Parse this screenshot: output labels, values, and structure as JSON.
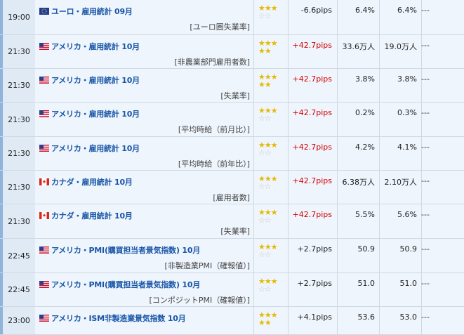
{
  "rows": [
    {
      "time": "19:00",
      "flag": "eu",
      "name": "ユーロ・雇用統計 09月",
      "sub": "[ユーロ圏失業率]",
      "stars_on": 3,
      "pips": "-6.6pips",
      "pips_sign": "neg",
      "prev": "6.4%",
      "forecast": "6.4%",
      "actual": "---"
    },
    {
      "time": "21:30",
      "flag": "us",
      "name": "アメリカ・雇用統計 10月",
      "sub": "[非農業部門雇用者数]",
      "stars_on": 5,
      "pips": "+42.7pips",
      "pips_sign": "pos",
      "prev": "33.6万人",
      "forecast": "19.0万人",
      "actual": "---"
    },
    {
      "time": "21:30",
      "flag": "us",
      "name": "アメリカ・雇用統計 10月",
      "sub": "[失業率]",
      "stars_on": 5,
      "pips": "+42.7pips",
      "pips_sign": "pos",
      "prev": "3.8%",
      "forecast": "3.8%",
      "actual": "---"
    },
    {
      "time": "21:30",
      "flag": "us",
      "name": "アメリカ・雇用統計 10月",
      "sub": "[平均時給（前月比）]",
      "stars_on": 3,
      "pips": "+42.7pips",
      "pips_sign": "pos",
      "prev": "0.2%",
      "forecast": "0.3%",
      "actual": "---"
    },
    {
      "time": "21:30",
      "flag": "us",
      "name": "アメリカ・雇用統計 10月",
      "sub": "[平均時給（前年比）]",
      "stars_on": 3,
      "pips": "+42.7pips",
      "pips_sign": "pos",
      "prev": "4.2%",
      "forecast": "4.1%",
      "actual": "---"
    },
    {
      "time": "21:30",
      "flag": "ca",
      "name": "カナダ・雇用統計 10月",
      "sub": "[雇用者数]",
      "stars_on": 3,
      "pips": "+42.7pips",
      "pips_sign": "pos",
      "prev": "6.38万人",
      "forecast": "2.10万人",
      "actual": "---"
    },
    {
      "time": "21:30",
      "flag": "ca",
      "name": "カナダ・雇用統計 10月",
      "sub": "[失業率]",
      "stars_on": 3,
      "pips": "+42.7pips",
      "pips_sign": "pos",
      "prev": "5.5%",
      "forecast": "5.6%",
      "actual": "---"
    },
    {
      "time": "22:45",
      "flag": "us",
      "name": "アメリカ・PMI(購買担当者景気指数) 10月",
      "sub": "[非製造業PMI（確報値）]",
      "stars_on": 3,
      "pips": "+2.7pips",
      "pips_sign": "neg",
      "prev": "50.9",
      "forecast": "50.9",
      "actual": "---"
    },
    {
      "time": "22:45",
      "flag": "us",
      "name": "アメリカ・PMI(購買担当者景気指数) 10月",
      "sub": "[コンポジットPMI（確報値）]",
      "stars_on": 3,
      "pips": "+2.7pips",
      "pips_sign": "neg",
      "prev": "51.0",
      "forecast": "51.0",
      "actual": "---"
    },
    {
      "time": "23:00",
      "flag": "us",
      "name": "アメリカ・ISM非製造業景気指数 10月",
      "sub": "",
      "stars_on": 5,
      "pips": "+4.1pips",
      "pips_sign": "neg",
      "prev": "53.6",
      "forecast": "53.0",
      "actual": "---"
    }
  ]
}
